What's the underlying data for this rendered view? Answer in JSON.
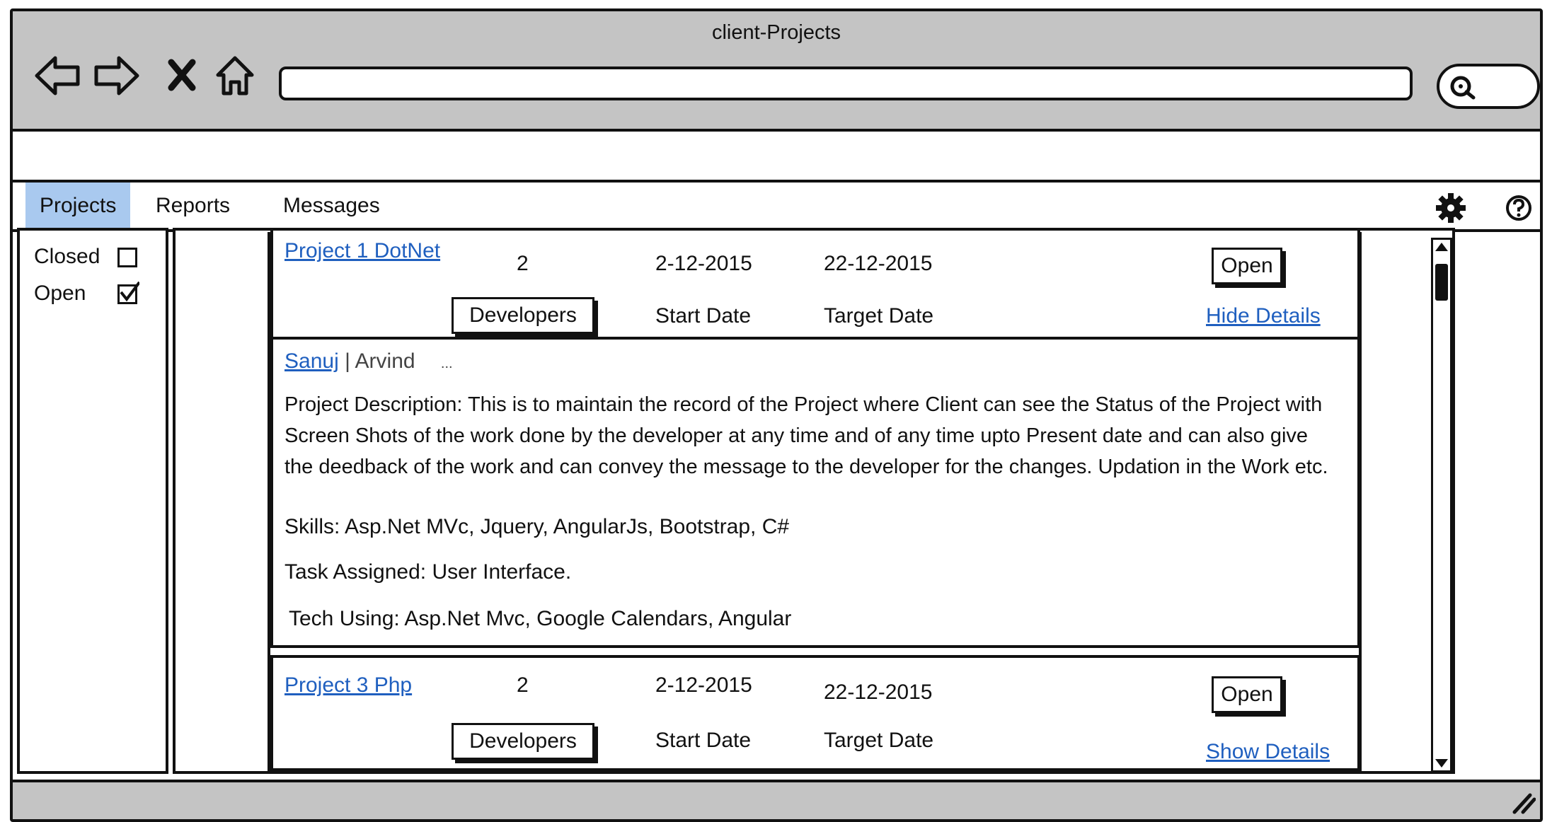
{
  "window": {
    "title": "client-Projects"
  },
  "nav": {
    "back_icon": "back-arrow-icon",
    "forward_icon": "forward-arrow-icon",
    "stop_icon": "close-icon",
    "home_icon": "home-icon",
    "url_value": "",
    "search_icon": "search-icon"
  },
  "menu": {
    "items": [
      {
        "label": "Projects",
        "active": true
      },
      {
        "label": "Reports",
        "active": false
      },
      {
        "label": "Messages",
        "active": false
      }
    ],
    "settings_icon": "gear-icon",
    "help_icon": "help-icon"
  },
  "filters": {
    "closed": {
      "label": "Closed",
      "checked": false
    },
    "open": {
      "label": "Open",
      "checked": true
    }
  },
  "projects": [
    {
      "name": "Project 1 DotNet",
      "developer_count": "2",
      "start_date": "2-12-2015",
      "target_date": "22-12-2015",
      "status_button": "Open",
      "developers_button": "Developers",
      "start_label": "Start Date",
      "target_label": "Target Date",
      "toggle_label": "Hide Details",
      "details": {
        "developers_line": {
          "first": "Sanuj",
          "rest": " | Arvind",
          "ellipsis": "..."
        },
        "description": "Project Description:   This is to maintain the record of the Project where Client can see the Status of the Project with Screen Shots of the work done by the developer at any time and of any time upto Present date and can also give the deedback of the work and can convey the message to the developer for the changes. Updation in the Work etc.",
        "skills": "Skills:   Asp.Net MVc, Jquery, AngularJs, Bootstrap, C#",
        "task": "Task Assigned: User Interface.",
        "tech": "Tech Using: Asp.Net Mvc, Google Calendars, Angular"
      }
    },
    {
      "name": "Project 3 Php",
      "developer_count": "2",
      "start_date": "2-12-2015",
      "target_date": "22-12-2015",
      "status_button": "Open",
      "developers_button": "Developers",
      "start_label": "Start Date",
      "target_label": "Target Date",
      "toggle_label": "Show Details"
    }
  ]
}
